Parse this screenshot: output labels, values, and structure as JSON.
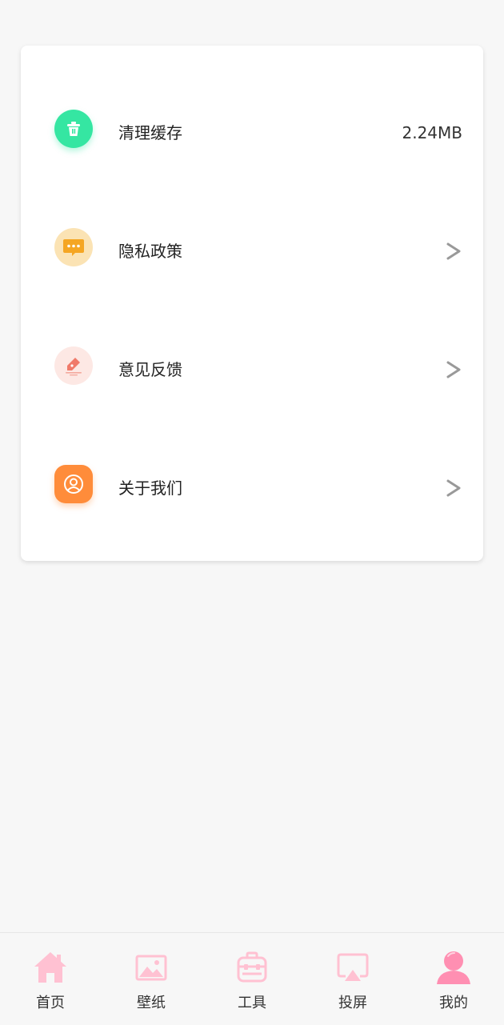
{
  "settings": {
    "items": [
      {
        "label": "清理缓存",
        "value": "2.24MB",
        "icon": "trash-icon",
        "color": "#2ee59d"
      },
      {
        "label": "隐私政策",
        "icon": "chat-icon",
        "color": "#f5a623"
      },
      {
        "label": "意见反馈",
        "icon": "edit-icon",
        "color": "#f07a6a"
      },
      {
        "label": "关于我们",
        "icon": "user-circle-icon",
        "color": "#ff8c3a"
      }
    ]
  },
  "tabbar": {
    "tabs": [
      {
        "label": "首页",
        "icon": "home-icon"
      },
      {
        "label": "壁纸",
        "icon": "image-icon"
      },
      {
        "label": "工具",
        "icon": "toolbox-icon"
      },
      {
        "label": "投屏",
        "icon": "cast-icon"
      },
      {
        "label": "我的",
        "icon": "profile-icon",
        "active": true
      }
    ],
    "icon_color": "#ffc1d2",
    "active_color": "#ff8fb2"
  }
}
